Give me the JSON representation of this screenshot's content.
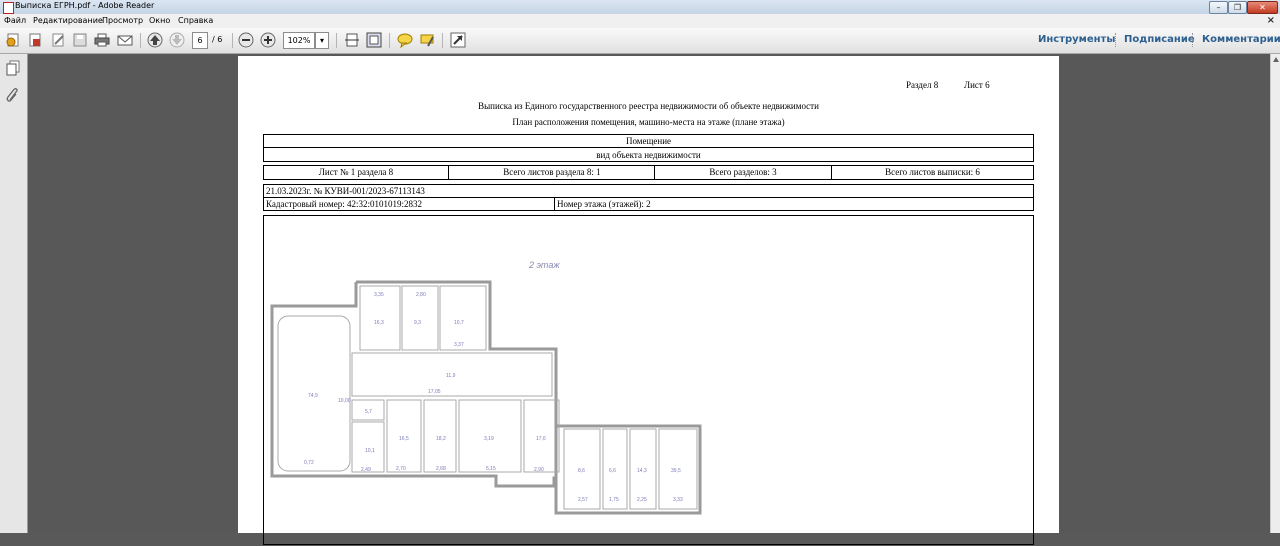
{
  "window": {
    "title": "Выписка ЕГРН.pdf - Adobe Reader"
  },
  "menu": {
    "items": [
      "Файл",
      "Редактирование",
      "Просмотр",
      "Окно",
      "Справка"
    ]
  },
  "toolbar": {
    "page_current": "6",
    "page_total": "/ 6",
    "zoom": "102%",
    "right_links": [
      "Инструменты",
      "Подписание",
      "Комментарии"
    ]
  },
  "document": {
    "header_section": "Раздел 8",
    "header_sheet": "Лист 6",
    "title": "Выписка из Единого государственного реестра недвижимости об объекте недвижимости",
    "subtitle": "План расположения помещения, машино-места на этаже (плане этажа)",
    "object_type": "Помещение",
    "object_type_caption": "вид объекта недвижимости",
    "sheet_info": [
      "Лист № 1 раздела 8",
      "Всего листов раздела 8: 1",
      "Всего разделов: 3",
      "Всего листов выписки: 6"
    ],
    "record_line": "21.03.2023г. № КУВИ-001/2023-67113143",
    "cadastral_number": "Кадастровый номер: 42:32:0101019:2832",
    "floor_number": "Номер этажа (этажей): 2",
    "floor_plan": {
      "caption": "2 этаж",
      "labels": [
        "3,35",
        "2,80",
        "9,3",
        "16,3",
        "10,7",
        "3,37",
        "11,9",
        "17,05",
        "74,9",
        "10,00",
        "0,72",
        "5,7",
        "10,1",
        "2,49",
        "16,5",
        "18,2",
        "3,19",
        "5,15",
        "17,6",
        "2,90",
        "2,68",
        "2,70",
        "8,6",
        "6,6",
        "14,3",
        "39,5",
        "2,57",
        "1,75",
        "2,25",
        "3,33"
      ]
    }
  }
}
